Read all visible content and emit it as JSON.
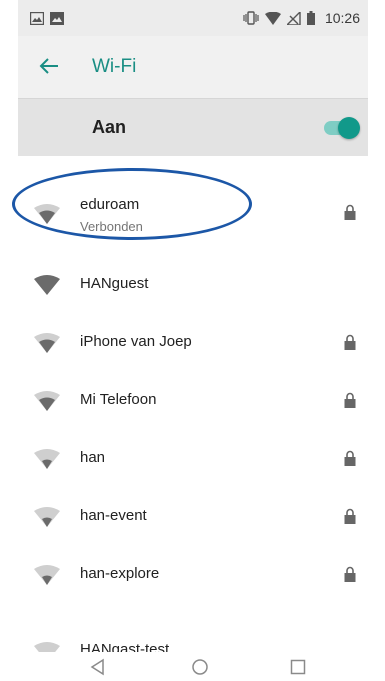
{
  "status_bar": {
    "time": "10:26",
    "icons": [
      "gallery-icon",
      "image-icon",
      "vibrate-icon",
      "wifi-icon",
      "no-signal-icon",
      "battery-icon"
    ]
  },
  "app_bar": {
    "title": "Wi-Fi",
    "back_icon": "arrow-left-icon"
  },
  "master_switch": {
    "label": "Aan",
    "on": true,
    "accent_color": "#11998a"
  },
  "networks": [
    {
      "name": "eduroam",
      "status": "Verbonden",
      "secured": true,
      "signal": "medium"
    },
    {
      "name": "HANguest",
      "status": "",
      "secured": false,
      "signal": "full"
    },
    {
      "name": "iPhone van Joep",
      "status": "",
      "secured": true,
      "signal": "medium"
    },
    {
      "name": "Mi Telefoon",
      "status": "",
      "secured": true,
      "signal": "medium"
    },
    {
      "name": "han",
      "status": "",
      "secured": true,
      "signal": "low"
    },
    {
      "name": "han-event",
      "status": "",
      "secured": true,
      "signal": "low"
    },
    {
      "name": "han-explore",
      "status": "",
      "secured": true,
      "signal": "low"
    },
    {
      "name": "HANgast-test",
      "status": "",
      "secured": false,
      "signal": "low"
    }
  ],
  "annotation": {
    "shape": "ellipse",
    "color": "#1c57a7"
  },
  "nav_bar": {
    "buttons": [
      "back-triangle-icon",
      "home-circle-icon",
      "recents-square-icon"
    ]
  }
}
